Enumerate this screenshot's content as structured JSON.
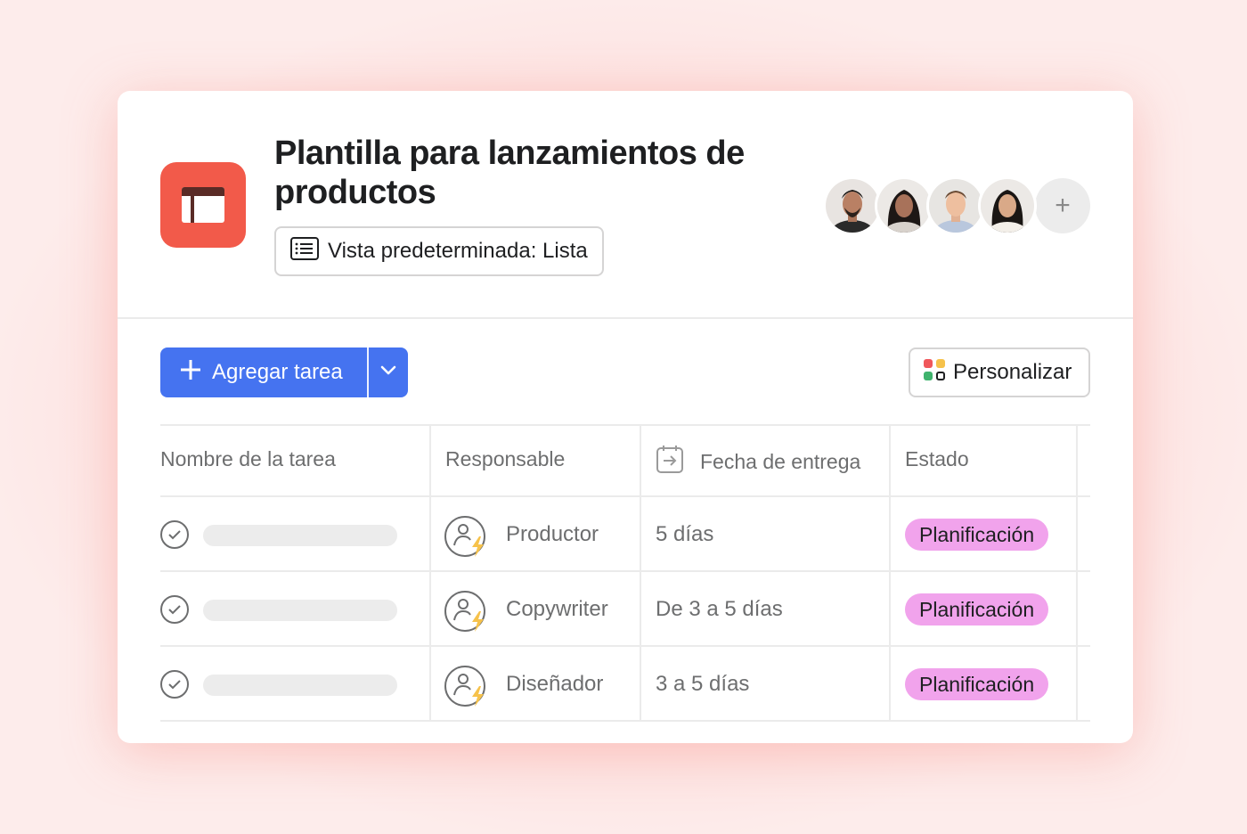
{
  "header": {
    "title": "Plantilla para lanzamientos de productos",
    "view_button": "Vista predeterminada: Lista",
    "add_member": "+"
  },
  "toolbar": {
    "add_task_label": "Agregar tarea",
    "customize_label": "Personalizar"
  },
  "table": {
    "columns": [
      "Nombre de la tarea",
      "Responsable",
      "Fecha de entrega",
      "Estado"
    ],
    "rows": [
      {
        "assignee": "Productor",
        "due": "5 días",
        "status": "Planificación"
      },
      {
        "assignee": "Copywriter",
        "due": "De 3 a 5 días",
        "status": "Planificación"
      },
      {
        "assignee": "Diseñador",
        "due": "3 a 5 días",
        "status": "Planificación"
      }
    ]
  },
  "colors": {
    "app_icon": "#f25a4a",
    "primary_button": "#4573f0",
    "status_badge": "#f1a3ec"
  },
  "icons": {
    "app": "template-window-icon",
    "view": "list-view-icon",
    "add": "plus-icon",
    "dropdown": "chevron-down-icon",
    "customize": "apps-grid-icon",
    "date_column": "calendar-arrow-icon",
    "task": "check-circle-icon",
    "role": "role-automation-icon"
  }
}
